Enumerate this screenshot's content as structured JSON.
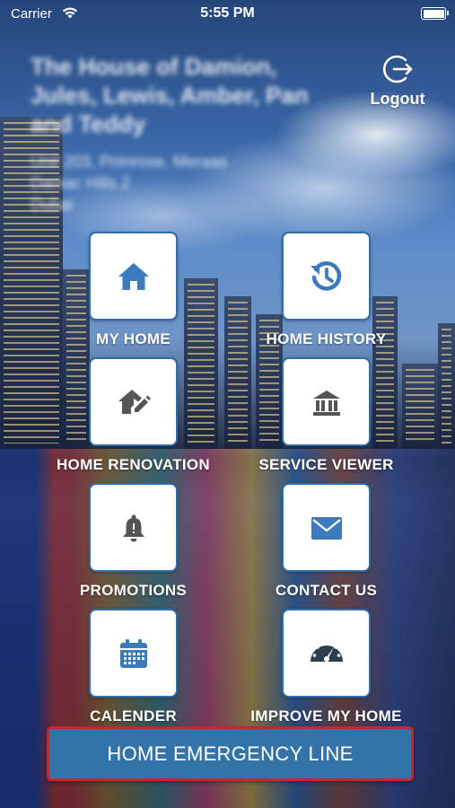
{
  "status_bar": {
    "carrier": "Carrier",
    "time": "5:55 PM"
  },
  "header": {
    "owner_name_line1": "The House of Damion,",
    "owner_name_line2": "Jules, Lewis, Amber, Pan",
    "owner_name_line3": "and Teddy",
    "address_line1": "Unit 203, Primrose, Meraas",
    "address_line2": "Damac Hills 2",
    "address_line3": "Dubai",
    "logout_label": "Logout"
  },
  "tiles": [
    {
      "label": "MY HOME",
      "icon": "home-icon"
    },
    {
      "label": "HOME HISTORY",
      "icon": "history-icon"
    },
    {
      "label": "HOME RENOVATION",
      "icon": "home-edit-icon"
    },
    {
      "label": "SERVICE VIEWER",
      "icon": "building-icon"
    },
    {
      "label": "PROMOTIONS",
      "icon": "bell-icon"
    },
    {
      "label": "CONTACT US",
      "icon": "envelope-icon"
    },
    {
      "label": "CALENDER",
      "icon": "calendar-icon"
    },
    {
      "label": "IMPROVE MY HOME",
      "icon": "gauge-icon"
    }
  ],
  "emergency_button": {
    "label": "HOME EMERGENCY LINE"
  },
  "colors": {
    "accent": "#2f6ea8",
    "icon": "#3b7bbd",
    "emergency_bg": "#3473a8",
    "emergency_border": "#c4282e"
  }
}
